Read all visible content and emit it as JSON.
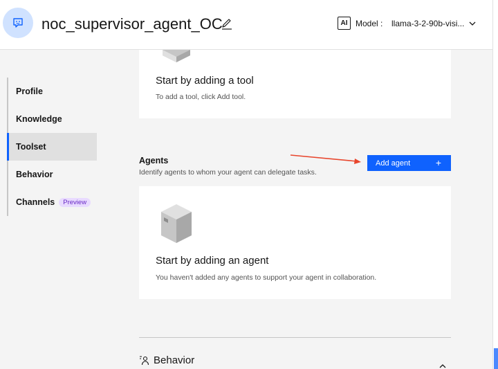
{
  "header": {
    "agent_name": "noc_supervisor_agent_OC",
    "ai_badge": "AI",
    "model_label": "Model :",
    "model_value": "llama-3-2-90b-visi..."
  },
  "sidenav": {
    "items": [
      {
        "label": "Profile"
      },
      {
        "label": "Knowledge"
      },
      {
        "label": "Toolset"
      },
      {
        "label": "Behavior"
      },
      {
        "label": "Channels",
        "tag": "Preview"
      }
    ],
    "active": "Toolset"
  },
  "tools": {
    "empty_title": "Start by adding a tool",
    "empty_desc": "To add a tool, click Add tool."
  },
  "agents": {
    "title": "Agents",
    "description": "Identify agents to whom your agent can delegate tasks.",
    "add_button": "Add agent",
    "add_button_icon": "+",
    "empty_title": "Start by adding an agent",
    "empty_desc": "You haven't added any agents to support your agent in collaboration."
  },
  "behavior": {
    "title": "Behavior"
  },
  "colors": {
    "accent": "#0f62fe",
    "arrow": "#e8452c",
    "avatar_bg": "#d0e2ff",
    "preview_tag": "#6929c4"
  }
}
